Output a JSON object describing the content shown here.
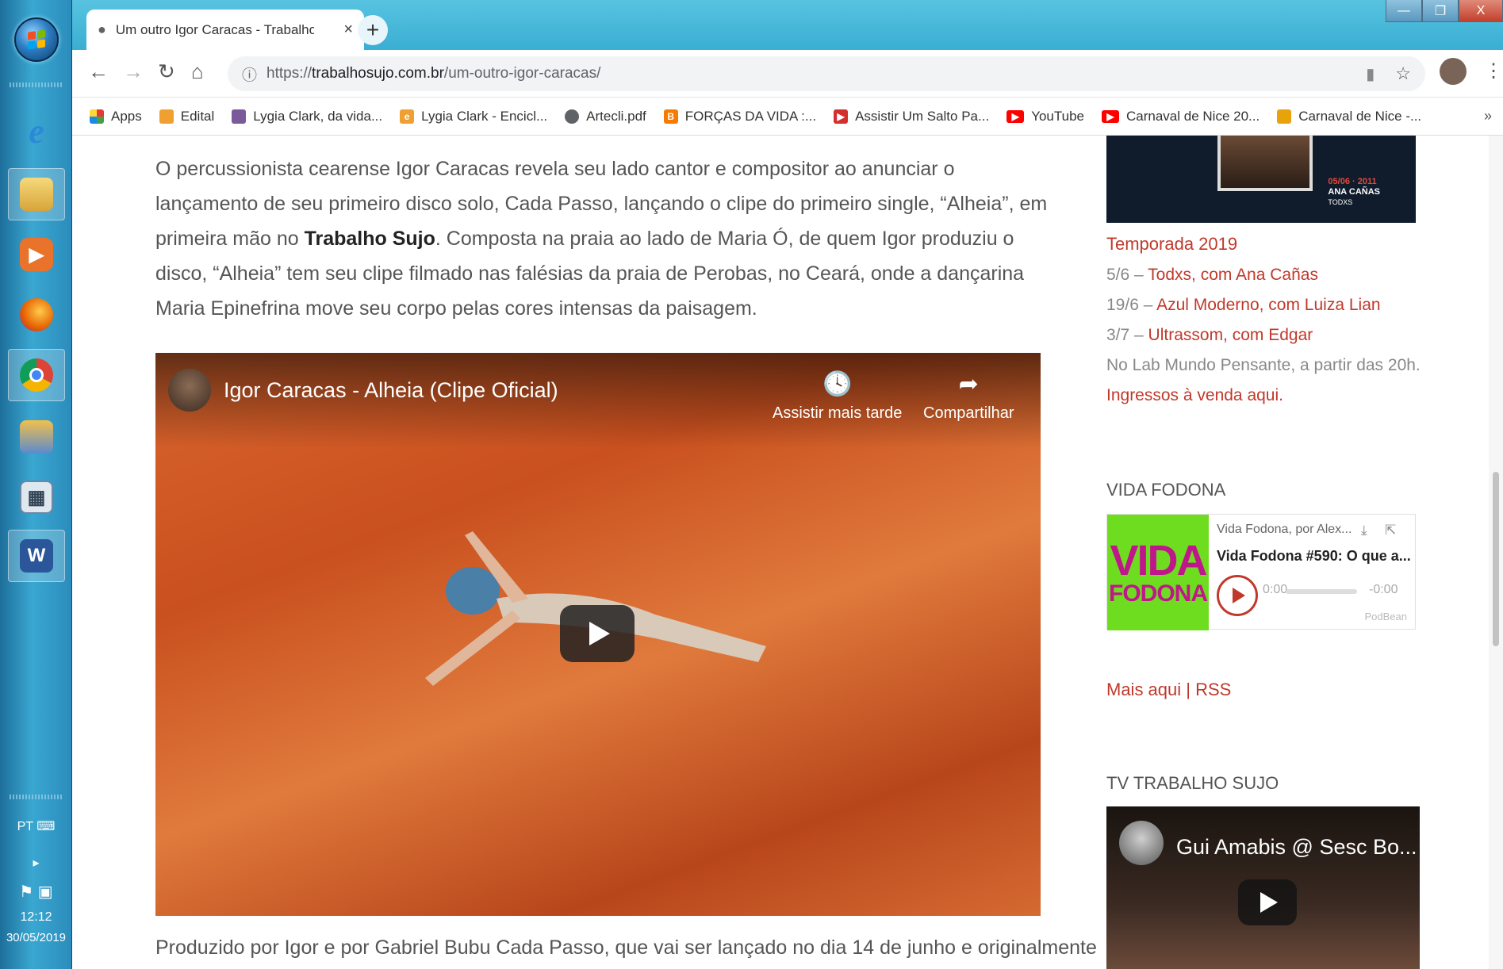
{
  "taskbar": {
    "icons": [
      "ie-icon",
      "file-explorer-icon",
      "media-player-icon",
      "firefox-icon",
      "chrome-icon",
      "paint-icon",
      "calculator-icon",
      "word-icon"
    ],
    "lang": "PT",
    "time": "12:12",
    "date": "30/05/2019"
  },
  "browser": {
    "tab_title": "Um outro Igor Caracas - Trabalho Sujo",
    "tab_close": "×",
    "new_tab": "+",
    "url": {
      "scheme": "https://",
      "host": "trabalhosujo.com.br",
      "path": "/um-outro-igor-caracas/"
    },
    "window_controls": {
      "minimize": "—",
      "maximize": "❐",
      "close": "X"
    }
  },
  "bookmarks": [
    {
      "label": "Apps",
      "icon": "apps-grid-icon",
      "color": "#e53935"
    },
    {
      "label": "Edital",
      "icon": "edital-icon",
      "color": "#f0a030"
    },
    {
      "label": "Lygia Clark, da vida...",
      "icon": "lygia-icon",
      "color": "#7a5a9a"
    },
    {
      "label": "Lygia Clark - Encicl...",
      "icon": "encyclopedia-icon",
      "color": "#f0a030"
    },
    {
      "label": "Artecli.pdf",
      "icon": "globe-icon",
      "color": "#5f6368"
    },
    {
      "label": "FORÇAS DA VIDA :...",
      "icon": "blogger-icon",
      "color": "#f57c00"
    },
    {
      "label": "Assistir Um Salto Pa...",
      "icon": "play-site-icon",
      "color": "#d32f2f"
    },
    {
      "label": "YouTube",
      "icon": "youtube-icon",
      "color": "#ff0000"
    },
    {
      "label": "Carnaval de Nice 20...",
      "icon": "youtube-icon",
      "color": "#ff0000"
    },
    {
      "label": "Carnaval de Nice -...",
      "icon": "carnival-icon",
      "color": "#e8a20c"
    }
  ],
  "bookmarks_more": "»",
  "article": {
    "para1_a": "O percussionista cearense Igor Caracas revela seu lado cantor e compositor ao anunciar o lançamento de seu primeiro disco solo, Cada Passo, lançando o clipe do primeiro single, “Alheia”, em primeira mão no ",
    "para1_strong": "Trabalho Sujo",
    "para1_b": ". Composta na praia ao lado de Maria Ó, de quem Igor produziu o disco, “Alheia” tem seu clipe filmado nas falésias da praia de Perobas, no Ceará, onde a dançarina Maria Epinefrina move seu corpo pelas cores intensas da paisagem.",
    "para2": "Produzido por Igor e por Gabriel Bubu Cada Passo, que vai ser lançado no dia 14 de junho e originalmente"
  },
  "video": {
    "title": "Igor Caracas - Alheia (Clipe Oficial)",
    "watch_later": "Assistir mais tarde",
    "share": "Compartilhar"
  },
  "sidebar": {
    "poster": {
      "date": "05/06 · 2011",
      "name": "ANA CAÑAS",
      "sub": "TODXS"
    },
    "season_title": "Temporada 2019",
    "season_items": [
      {
        "date": "5/6 – ",
        "link": "Todxs, com Ana Cañas"
      },
      {
        "date": "19/6 – ",
        "link": "Azul Moderno, com Luiza Lian"
      },
      {
        "date": "3/7 – ",
        "link": "Ultrassom, com Edgar"
      }
    ],
    "season_note": "No Lab Mundo Pensante, a partir das 20h.",
    "tickets": "Ingressos à venda aqui.",
    "vida_title": "VIDA FODONA",
    "podcast": {
      "logo_line1": "VIDA",
      "logo_line2": "FODONA",
      "show": "Vida Fodona, por Alex...",
      "episode": "Vida Fodona #590: O que a...",
      "time_start": "0:00",
      "time_end": "-0:00",
      "brand": "PodBean"
    },
    "more": "Mais aqui | RSS",
    "tv_title": "TV TRABALHO SUJO",
    "tv_video_title": "Gui Amabis @ Sesc Bo..."
  }
}
